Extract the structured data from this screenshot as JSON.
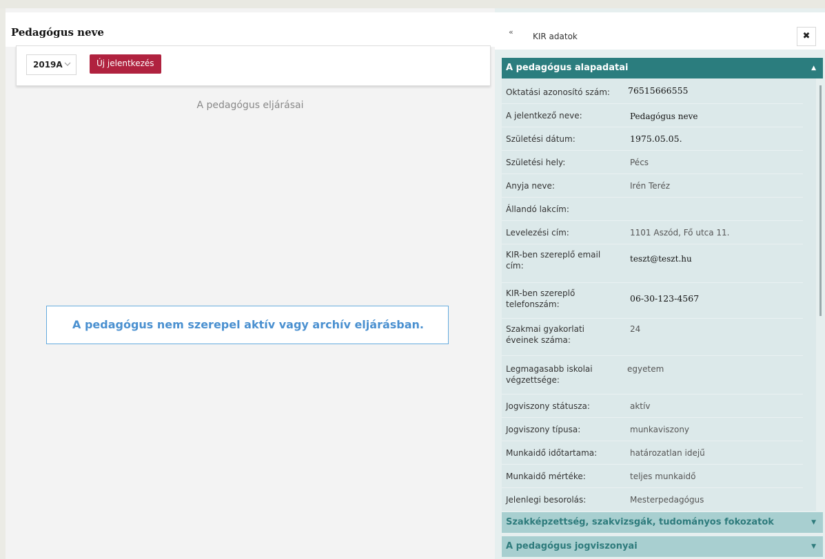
{
  "left": {
    "title": "Pedagógus neve",
    "year": "2019A",
    "new_button": "Új jelentkezés",
    "subtitle": "A pedagógus eljárásai",
    "empty_message": "A pedagógus nem szerepel aktív vagy archív eljárásban."
  },
  "right": {
    "collapse_glyph": "«",
    "title": "KIR adatok",
    "close_glyph": "✖",
    "section_open": "A pedagógus alapadatai",
    "fields": [
      {
        "label": "Oktatási azonosító szám:",
        "value": "76515666555"
      },
      {
        "label": "A jelentkező neve:",
        "value": "Pedagógus neve"
      },
      {
        "label": "Születési dátum:",
        "value": "1975.05.05."
      },
      {
        "label": "Születési hely:",
        "value": "Pécs"
      },
      {
        "label": "Anyja neve:",
        "value": "Irén Teréz"
      },
      {
        "label": "Állandó lakcím:",
        "value": ""
      },
      {
        "label": "Levelezési cím:",
        "value": "1101 Aszód, Fő utca 11."
      },
      {
        "label": "KIR-ben szereplő email cím:",
        "value": "teszt@teszt.hu"
      },
      {
        "label": "KIR-ben szereplő telefonszám:",
        "value": "06-30-123-4567"
      },
      {
        "label": "Szakmai gyakorlati éveinek száma:",
        "value": "24"
      },
      {
        "label": "Legmagasabb iskolai végzettsége:",
        "value": "egyetem"
      },
      {
        "label": "Jogviszony státusza:",
        "value": "aktív"
      },
      {
        "label": "Jogviszony típusa:",
        "value": "munkaviszony"
      },
      {
        "label": "Munkaidő időtartama:",
        "value": "határozatlan idejű"
      },
      {
        "label": "Munkaidő mértéke:",
        "value": "teljes munkaidő"
      },
      {
        "label": "Jelenlegi besorolás:",
        "value": "Mesterpedagógus"
      }
    ],
    "section_2": "Szakképzettség, szakvizsgák, tudományos fokozatok",
    "section_3": "A pedagógus jogviszonyai",
    "caret_up": "▲",
    "caret_down": "▼"
  },
  "colors": {
    "accent_button": "#b0223f",
    "section_header": "#2b7d7e",
    "section_closed": "#a8cfd0",
    "info_border": "#63a9dd"
  }
}
